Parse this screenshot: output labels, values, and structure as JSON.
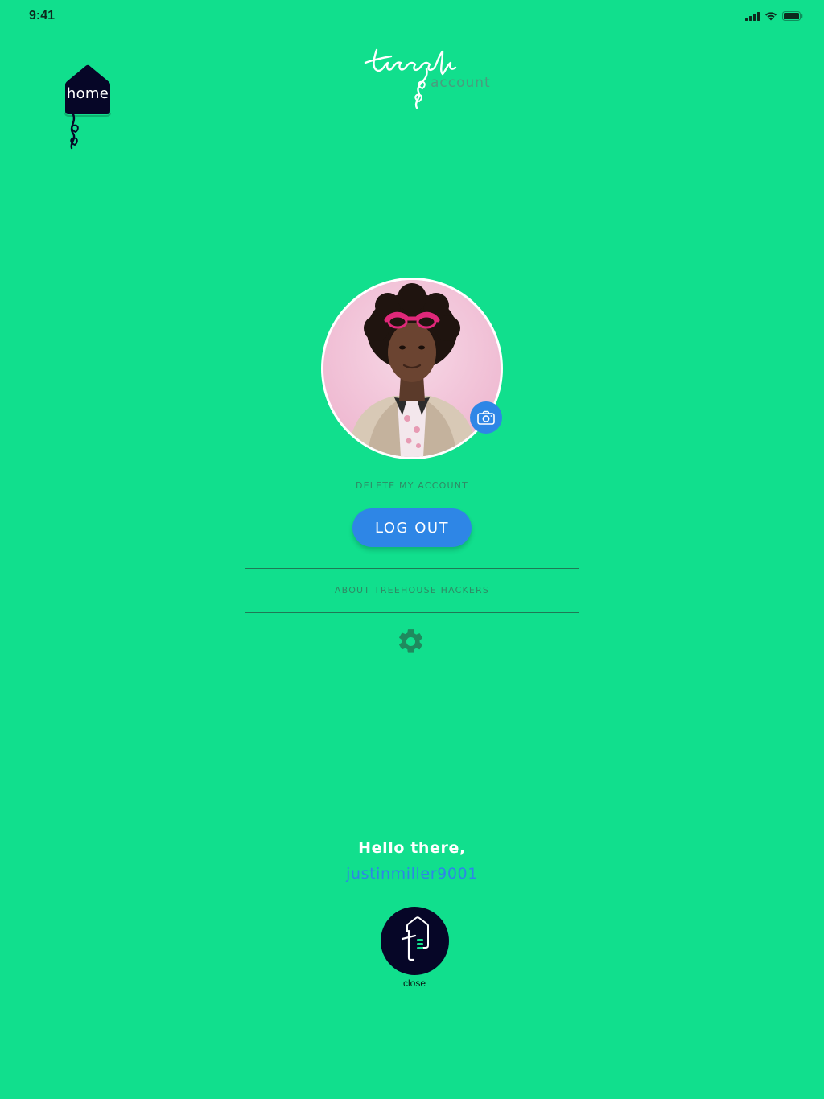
{
  "status_bar": {
    "time": "9:41",
    "icons": [
      "signal-icon",
      "wifi-icon",
      "battery-icon"
    ]
  },
  "home_badge": {
    "label": "home",
    "color": "#060627"
  },
  "brand": {
    "logo_text": "treeple",
    "section": "account"
  },
  "profile": {
    "avatar_alt": "profile photo",
    "camera_icon": "camera-icon",
    "delete_label": "DELETE MY ACCOUNT",
    "logout_label": "LOG OUT"
  },
  "menu": {
    "about_label": "ABOUT TREEHOUSE HACKERS",
    "settings_icon": "gear-icon"
  },
  "greeting": {
    "text": "Hello there,",
    "username": "justinmiller9001"
  },
  "close": {
    "label": "close",
    "icon": "treeple-logo-icon"
  },
  "colors": {
    "background": "#11df8d",
    "accent": "#2e86e6",
    "dark": "#060627",
    "muted_text": "#2f8a65"
  }
}
